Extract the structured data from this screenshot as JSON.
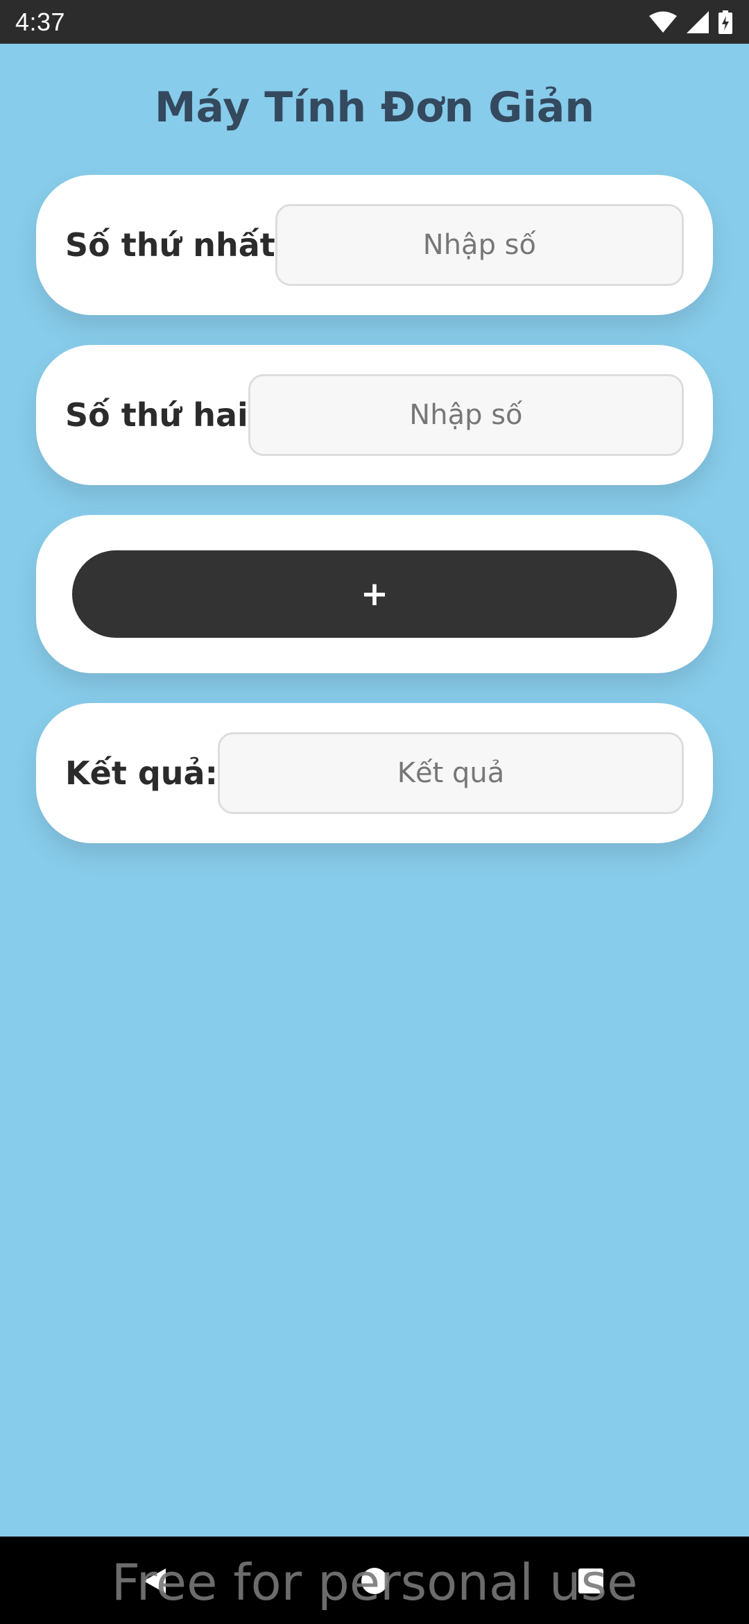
{
  "status_bar": {
    "time": "4:37",
    "icons": [
      "wifi-icon",
      "signal-icon",
      "battery-charging-icon"
    ]
  },
  "app": {
    "title": "Máy Tính Đơn Giản"
  },
  "first_number": {
    "label": "Số thứ nhất",
    "placeholder": "Nhập số",
    "value": ""
  },
  "second_number": {
    "label": "Số thứ hai",
    "placeholder": "Nhập số",
    "value": ""
  },
  "operation": {
    "button_label": "+"
  },
  "result": {
    "label": "Kết quả:",
    "placeholder": "Kết quả",
    "value": ""
  },
  "nav_bar": {
    "buttons": [
      "back-icon",
      "home-icon",
      "recents-icon"
    ]
  },
  "watermark": "Free for personal use",
  "colors": {
    "background": "#87CCEA",
    "card": "#FFFFFF",
    "title": "#34495E",
    "button": "#333333",
    "status_bar": "#2C2C2C",
    "nav_bar": "#000000"
  }
}
